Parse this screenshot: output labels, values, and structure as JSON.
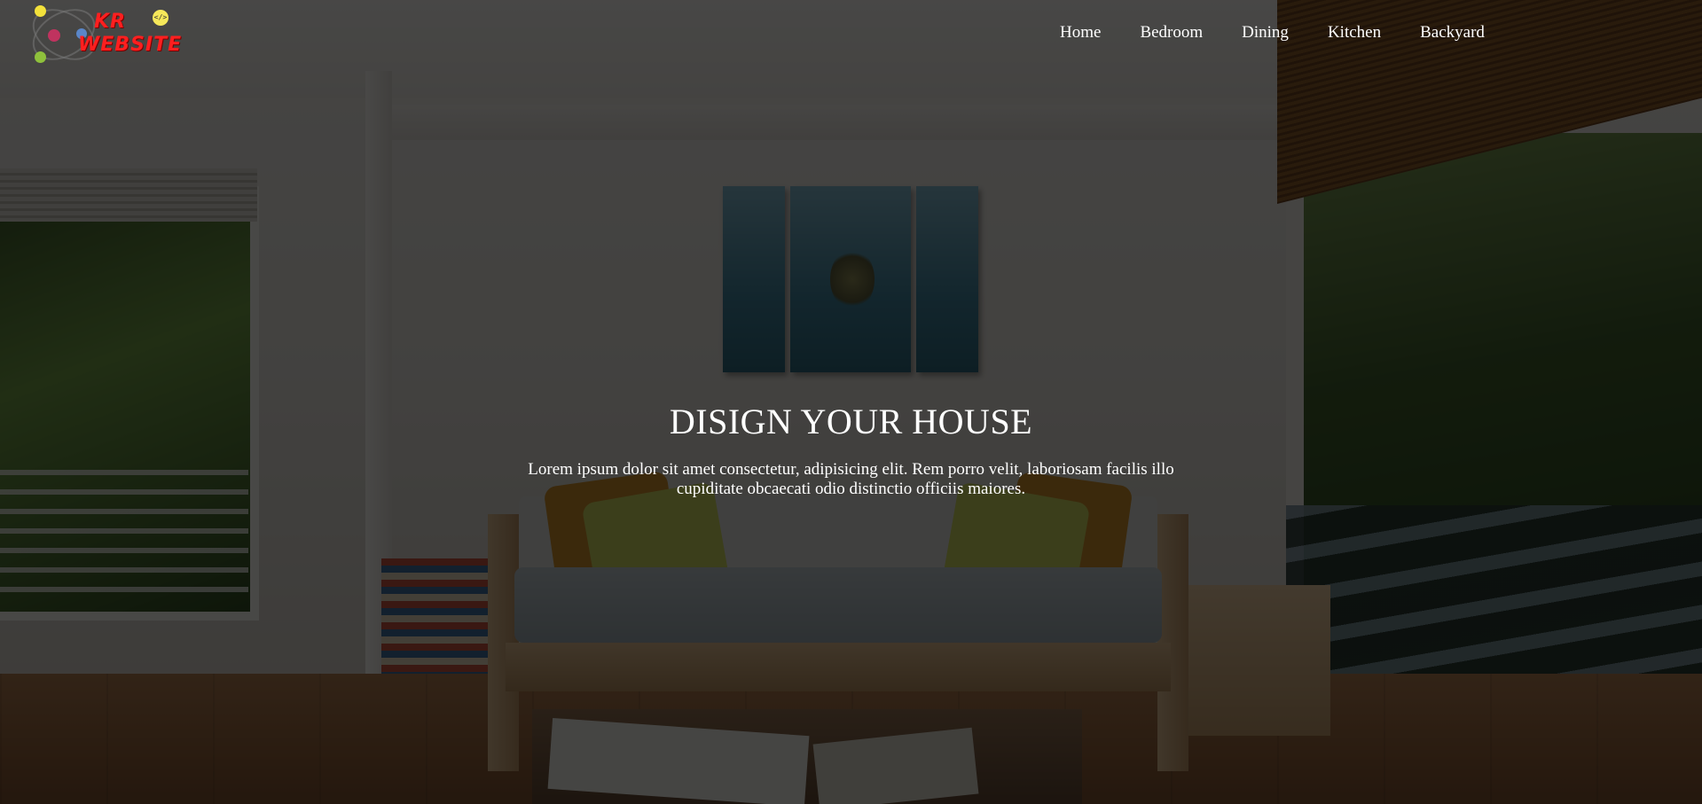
{
  "logo": {
    "line1": "KR",
    "line2": "WEBSITE",
    "badge": "</>"
  },
  "nav": {
    "items": [
      "Home",
      "Bedroom",
      "Dining",
      "Kitchen",
      "Backyard"
    ]
  },
  "hero": {
    "title": "DISIGN YOUR HOUSE",
    "description": "Lorem ipsum dolor sit amet consectetur, adipisicing elit. Rem porro velit, laboriosam facilis illo cupiditate obcaecati odio distinctio officiis maiores."
  },
  "colors": {
    "overlay": "#000000",
    "text": "#ffffff",
    "logo_red": "#ff1f1f"
  }
}
